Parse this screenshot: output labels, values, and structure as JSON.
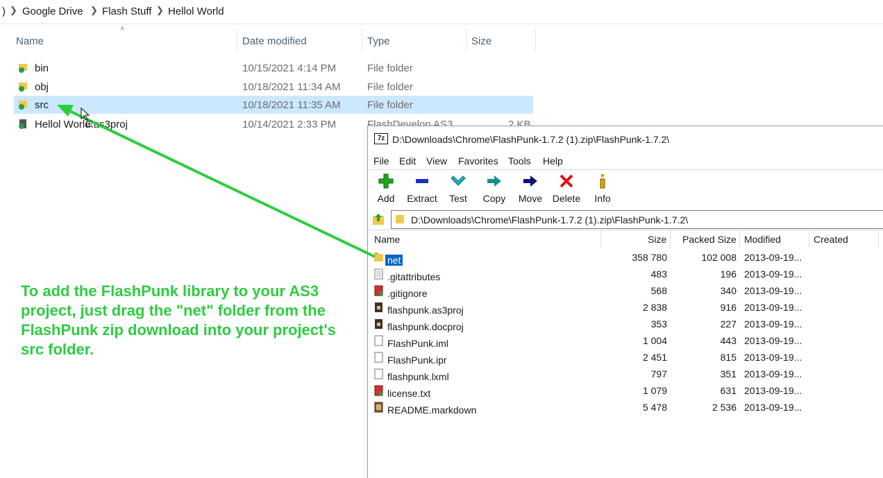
{
  "explorer": {
    "breadcrumb": [
      ")",
      "Google Drive",
      "Flash Stuff",
      "Hellol World"
    ],
    "columns": {
      "name": "Name",
      "date": "Date modified",
      "type": "Type",
      "size": "Size"
    },
    "rows": [
      {
        "name": "bin",
        "date": "10/15/2021 4:14 PM",
        "type": "File folder",
        "size": ""
      },
      {
        "name": "obj",
        "date": "10/18/2021 11:34 AM",
        "type": "File folder",
        "size": ""
      },
      {
        "name": "src",
        "date": "10/18/2021 11:35 AM",
        "type": "File folder",
        "size": "",
        "selected": true
      },
      {
        "name": "Hellol World.as3proj",
        "date": "10/14/2021 2:33 PM",
        "type": "FlashDevelop AS3",
        "size": "2 KB"
      }
    ]
  },
  "zip": {
    "title": "D:\\Downloads\\Chrome\\FlashPunk-1.7.2 (1).zip\\FlashPunk-1.7.2\\",
    "logo": "7z",
    "menu": [
      "File",
      "Edit",
      "View",
      "Favorites",
      "Tools",
      "Help"
    ],
    "toolbar": [
      {
        "label": "Add",
        "icon": "plus-icon",
        "color": "#1fa81f"
      },
      {
        "label": "Extract",
        "icon": "minus-icon",
        "color": "#1a2fc4"
      },
      {
        "label": "Test",
        "icon": "check-down-icon",
        "color": "#1ab0c8"
      },
      {
        "label": "Copy",
        "icon": "arrow-right-icon",
        "color": "#1a8f8f"
      },
      {
        "label": "Move",
        "icon": "arrow-right-icon",
        "color": "#101070"
      },
      {
        "label": "Delete",
        "icon": "x-icon",
        "color": "#e01010"
      },
      {
        "label": "Info",
        "icon": "info-icon",
        "color": "#d4a800"
      }
    ],
    "address": "D:\\Downloads\\Chrome\\FlashPunk-1.7.2 (1).zip\\FlashPunk-1.7.2\\",
    "columns": {
      "name": "Name",
      "size": "Size",
      "packed": "Packed Size",
      "modified": "Modified",
      "created": "Created"
    },
    "rows": [
      {
        "name": "net",
        "size": "358 780",
        "packed": "102 008",
        "modified": "2013-09-19...",
        "icon": "folder-icon",
        "selected": true
      },
      {
        "name": ".gitattributes",
        "size": "483",
        "packed": "196",
        "modified": "2013-09-19...",
        "icon": "text-file-icon"
      },
      {
        "name": ".gitignore",
        "size": "568",
        "packed": "340",
        "modified": "2013-09-19...",
        "icon": "red-file-icon"
      },
      {
        "name": "flashpunk.as3proj",
        "size": "2 838",
        "packed": "916",
        "modified": "2013-09-19...",
        "icon": "project-file-icon"
      },
      {
        "name": "flashpunk.docproj",
        "size": "353",
        "packed": "227",
        "modified": "2013-09-19...",
        "icon": "project-file-icon"
      },
      {
        "name": "FlashPunk.iml",
        "size": "1 004",
        "packed": "443",
        "modified": "2013-09-19...",
        "icon": "blank-file-icon"
      },
      {
        "name": "FlashPunk.ipr",
        "size": "2 451",
        "packed": "815",
        "modified": "2013-09-19...",
        "icon": "blank-file-icon"
      },
      {
        "name": "flashpunk.lxml",
        "size": "797",
        "packed": "351",
        "modified": "2013-09-19...",
        "icon": "blank-file-icon"
      },
      {
        "name": "license.txt",
        "size": "1 079",
        "packed": "631",
        "modified": "2013-09-19...",
        "icon": "red-file-icon"
      },
      {
        "name": "README.markdown",
        "size": "5 478",
        "packed": "2 536",
        "modified": "2013-09-19...",
        "icon": "image-file-icon"
      }
    ]
  },
  "annotation": {
    "text": "To add the FlashPunk library to your AS3 project, just drag the \"net\" folder from the FlashPunk zip download into your project's src folder.",
    "color": "#2ecc40"
  }
}
